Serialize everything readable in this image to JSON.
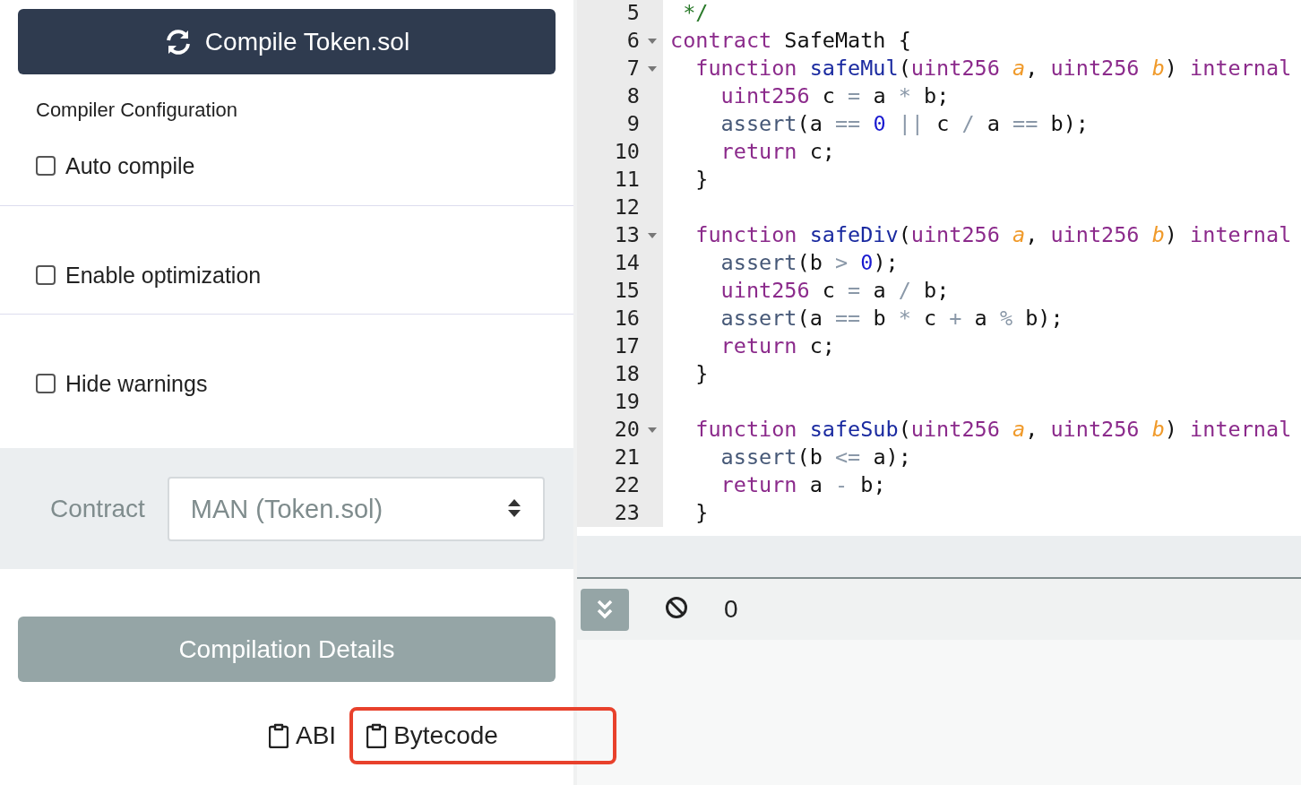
{
  "compile_button": {
    "label": "Compile Token.sol"
  },
  "config": {
    "heading": "Compiler Configuration",
    "options": [
      {
        "label": "Auto compile",
        "checked": false
      },
      {
        "label": "Enable optimization",
        "checked": false
      },
      {
        "label": "Hide warnings",
        "checked": false
      }
    ]
  },
  "contract": {
    "label": "Contract",
    "value": "MAN (Token.sol)"
  },
  "details_button": {
    "label": "Compilation Details"
  },
  "copy_links": [
    {
      "label": "ABI",
      "highlighted": false
    },
    {
      "label": "Bytecode",
      "highlighted": true
    }
  ],
  "editor": {
    "lines": [
      {
        "number": "5",
        "foldable": false,
        "tokens": [
          {
            "kind": "comment",
            "text": " */"
          }
        ]
      },
      {
        "number": "6",
        "foldable": true,
        "tokens": [
          {
            "kind": "keyword",
            "text": "contract"
          },
          {
            "kind": "plain",
            "text": " SafeMath {"
          }
        ]
      },
      {
        "number": "7",
        "foldable": true,
        "tokens": [
          {
            "kind": "keyword",
            "text": "  function"
          },
          {
            "kind": "function",
            "text": " safeMul"
          },
          {
            "kind": "plain",
            "text": "("
          },
          {
            "kind": "keyword",
            "text": "uint256"
          },
          {
            "kind": "param",
            "text": " a"
          },
          {
            "kind": "plain",
            "text": ", "
          },
          {
            "kind": "keyword",
            "text": "uint256"
          },
          {
            "kind": "param",
            "text": " b"
          },
          {
            "kind": "plain",
            "text": ") "
          },
          {
            "kind": "keyword",
            "text": "internal"
          }
        ]
      },
      {
        "number": "8",
        "foldable": false,
        "tokens": [
          {
            "kind": "keyword",
            "text": "    uint256"
          },
          {
            "kind": "plain",
            "text": " c "
          },
          {
            "kind": "operator",
            "text": "="
          },
          {
            "kind": "plain",
            "text": " a "
          },
          {
            "kind": "operator",
            "text": "*"
          },
          {
            "kind": "plain",
            "text": " b;"
          }
        ]
      },
      {
        "number": "9",
        "foldable": false,
        "tokens": [
          {
            "kind": "builtin",
            "text": "    assert"
          },
          {
            "kind": "plain",
            "text": "(a "
          },
          {
            "kind": "operator",
            "text": "=="
          },
          {
            "kind": "number",
            "text": " 0"
          },
          {
            "kind": "operator",
            "text": " ||"
          },
          {
            "kind": "plain",
            "text": " c "
          },
          {
            "kind": "operator",
            "text": "/"
          },
          {
            "kind": "plain",
            "text": " a "
          },
          {
            "kind": "operator",
            "text": "=="
          },
          {
            "kind": "plain",
            "text": " b);"
          }
        ]
      },
      {
        "number": "10",
        "foldable": false,
        "tokens": [
          {
            "kind": "keyword",
            "text": "    return"
          },
          {
            "kind": "plain",
            "text": " c;"
          }
        ]
      },
      {
        "number": "11",
        "foldable": false,
        "tokens": [
          {
            "kind": "plain",
            "text": "  }"
          }
        ]
      },
      {
        "number": "12",
        "foldable": false
      },
      {
        "number": "13",
        "foldable": true,
        "tokens": [
          {
            "kind": "keyword",
            "text": "  function"
          },
          {
            "kind": "function",
            "text": " safeDiv"
          },
          {
            "kind": "plain",
            "text": "("
          },
          {
            "kind": "keyword",
            "text": "uint256"
          },
          {
            "kind": "param",
            "text": " a"
          },
          {
            "kind": "plain",
            "text": ", "
          },
          {
            "kind": "keyword",
            "text": "uint256"
          },
          {
            "kind": "param",
            "text": " b"
          },
          {
            "kind": "plain",
            "text": ") "
          },
          {
            "kind": "keyword",
            "text": "internal"
          }
        ]
      },
      {
        "number": "14",
        "foldable": false,
        "tokens": [
          {
            "kind": "builtin",
            "text": "    assert"
          },
          {
            "kind": "plain",
            "text": "(b "
          },
          {
            "kind": "operator",
            "text": ">"
          },
          {
            "kind": "number",
            "text": " 0"
          },
          {
            "kind": "plain",
            "text": ");"
          }
        ]
      },
      {
        "number": "15",
        "foldable": false,
        "tokens": [
          {
            "kind": "keyword",
            "text": "    uint256"
          },
          {
            "kind": "plain",
            "text": " c "
          },
          {
            "kind": "operator",
            "text": "="
          },
          {
            "kind": "plain",
            "text": " a "
          },
          {
            "kind": "operator",
            "text": "/"
          },
          {
            "kind": "plain",
            "text": " b;"
          }
        ]
      },
      {
        "number": "16",
        "foldable": false,
        "tokens": [
          {
            "kind": "builtin",
            "text": "    assert"
          },
          {
            "kind": "plain",
            "text": "(a "
          },
          {
            "kind": "operator",
            "text": "=="
          },
          {
            "kind": "plain",
            "text": " b "
          },
          {
            "kind": "operator",
            "text": "*"
          },
          {
            "kind": "plain",
            "text": " c "
          },
          {
            "kind": "operator",
            "text": "+"
          },
          {
            "kind": "plain",
            "text": " a "
          },
          {
            "kind": "operator",
            "text": "%"
          },
          {
            "kind": "plain",
            "text": " b);"
          }
        ]
      },
      {
        "number": "17",
        "foldable": false,
        "tokens": [
          {
            "kind": "keyword",
            "text": "    return"
          },
          {
            "kind": "plain",
            "text": " c;"
          }
        ]
      },
      {
        "number": "18",
        "foldable": false,
        "tokens": [
          {
            "kind": "plain",
            "text": "  }"
          }
        ]
      },
      {
        "number": "19",
        "foldable": false
      },
      {
        "number": "20",
        "foldable": true,
        "tokens": [
          {
            "kind": "keyword",
            "text": "  function"
          },
          {
            "kind": "function",
            "text": " safeSub"
          },
          {
            "kind": "plain",
            "text": "("
          },
          {
            "kind": "keyword",
            "text": "uint256"
          },
          {
            "kind": "param",
            "text": " a"
          },
          {
            "kind": "plain",
            "text": ", "
          },
          {
            "kind": "keyword",
            "text": "uint256"
          },
          {
            "kind": "param",
            "text": " b"
          },
          {
            "kind": "plain",
            "text": ") "
          },
          {
            "kind": "keyword",
            "text": "internal"
          }
        ]
      },
      {
        "number": "21",
        "foldable": false,
        "tokens": [
          {
            "kind": "builtin",
            "text": "    assert"
          },
          {
            "kind": "plain",
            "text": "(b "
          },
          {
            "kind": "operator",
            "text": "<="
          },
          {
            "kind": "plain",
            "text": " a);"
          }
        ]
      },
      {
        "number": "22",
        "foldable": false,
        "tokens": [
          {
            "kind": "keyword",
            "text": "    return"
          },
          {
            "kind": "plain",
            "text": " a "
          },
          {
            "kind": "operator",
            "text": "-"
          },
          {
            "kind": "plain",
            "text": " b;"
          }
        ]
      },
      {
        "number": "23",
        "foldable": false,
        "tokens": [
          {
            "kind": "plain",
            "text": "  }"
          }
        ]
      }
    ]
  },
  "terminal": {
    "count": "0"
  }
}
